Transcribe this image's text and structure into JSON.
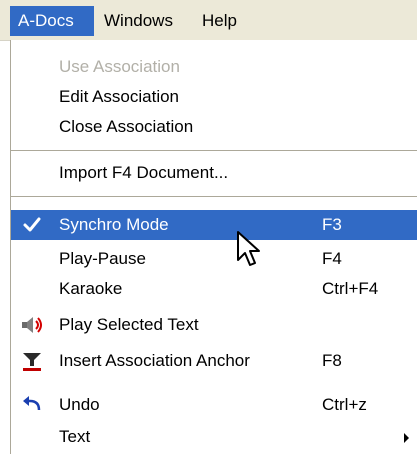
{
  "menubar": {
    "items": [
      {
        "label": "A-Docs"
      },
      {
        "label": "Windows"
      },
      {
        "label": "Help"
      }
    ]
  },
  "menu": {
    "items": [
      {
        "label": "Use Association",
        "state": "disabled"
      },
      {
        "label": "Edit Association"
      },
      {
        "label": "Close Association"
      },
      {
        "label": "Import F4 Document..."
      },
      {
        "label": "Synchro Mode",
        "shortcut": "F3",
        "icon": "check-icon",
        "state": "selected"
      },
      {
        "label": "Play-Pause",
        "shortcut": "F4"
      },
      {
        "label": "Karaoke",
        "shortcut": "Ctrl+F4"
      },
      {
        "label": "Play Selected Text",
        "icon": "speaker-icon"
      },
      {
        "label": "Insert Association Anchor",
        "shortcut": "F8",
        "icon": "anchor-icon"
      },
      {
        "label": "Undo",
        "shortcut": "Ctrl+z",
        "icon": "undo-icon"
      },
      {
        "label": "Text",
        "icon": "submenu-arrow-icon"
      }
    ]
  },
  "colors": {
    "menubar_bg": "#ece9d8",
    "highlight": "#316ac5",
    "disabled_text": "#b2b0a8"
  }
}
